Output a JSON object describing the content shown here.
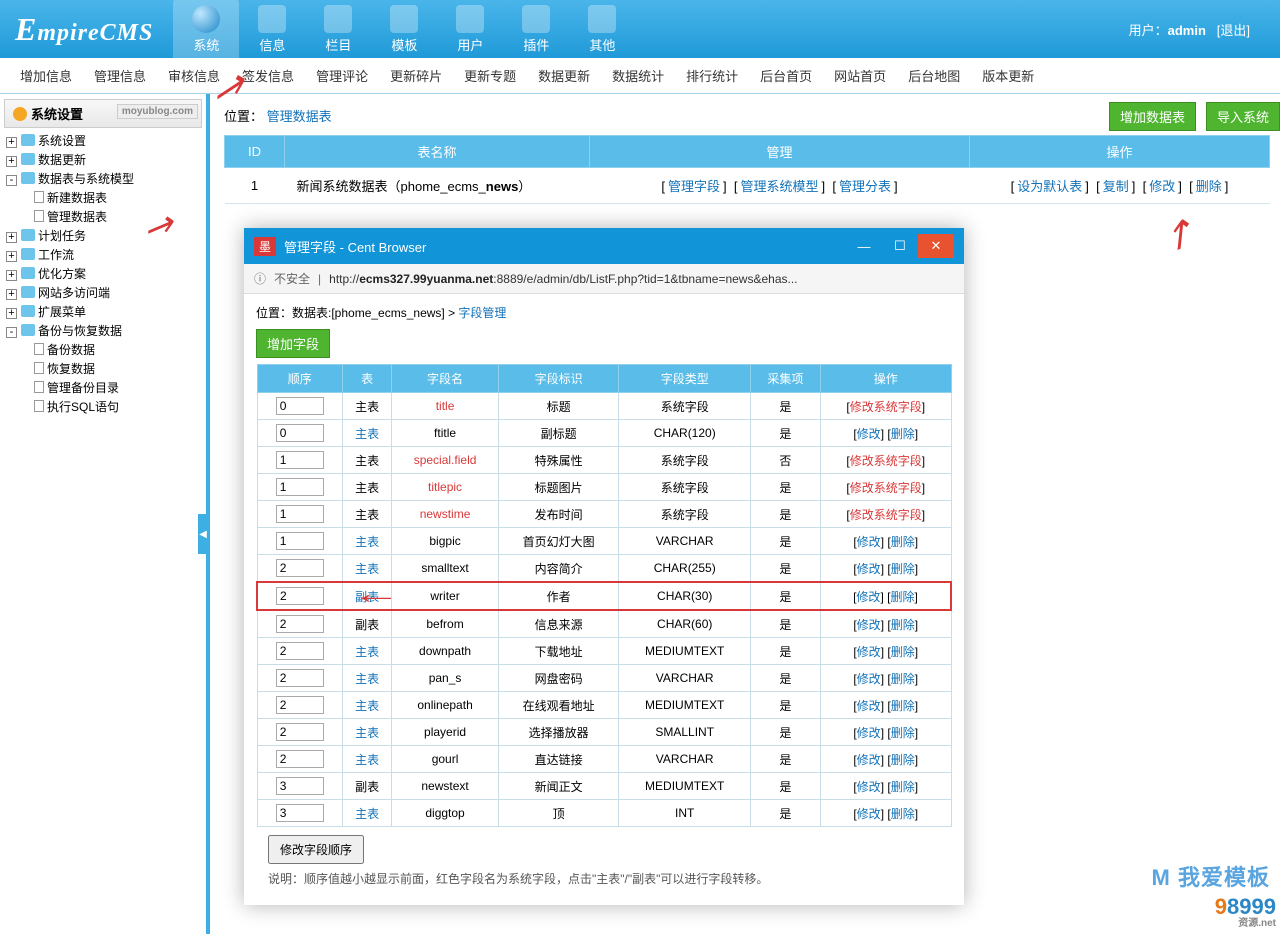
{
  "header": {
    "logo": "EmpireCMS",
    "tabs": [
      "系统",
      "信息",
      "栏目",
      "模板",
      "用户",
      "插件",
      "其他"
    ],
    "active_tab": 0,
    "user_label": "用户：",
    "user_name": "admin",
    "logout": "退出"
  },
  "subnav": [
    "增加信息",
    "管理信息",
    "审核信息",
    "签发信息",
    "管理评论",
    "更新碎片",
    "更新专题",
    "数据更新",
    "数据统计",
    "排行统计",
    "后台首页",
    "网站首页",
    "后台地图",
    "版本更新"
  ],
  "sidebar": {
    "title": "系统设置",
    "watermark": "moyublog.com",
    "items": [
      {
        "label": "系统设置",
        "toggle": "+"
      },
      {
        "label": "数据更新",
        "toggle": "+"
      },
      {
        "label": "数据表与系统模型",
        "toggle": "-",
        "children": [
          {
            "label": "新建数据表"
          },
          {
            "label": "管理数据表"
          }
        ]
      },
      {
        "label": "计划任务",
        "toggle": "+"
      },
      {
        "label": "工作流",
        "toggle": "+"
      },
      {
        "label": "优化方案",
        "toggle": "+"
      },
      {
        "label": "网站多访问端",
        "toggle": "+"
      },
      {
        "label": "扩展菜单",
        "toggle": "+"
      },
      {
        "label": "备份与恢复数据",
        "toggle": "-",
        "children": [
          {
            "label": "备份数据"
          },
          {
            "label": "恢复数据"
          },
          {
            "label": "管理备份目录"
          },
          {
            "label": "执行SQL语句"
          }
        ]
      }
    ]
  },
  "content": {
    "breadcrumb_pos": "位置：",
    "breadcrumb_link": "管理数据表",
    "btn_add": "增加数据表",
    "btn_import": "导入系统",
    "table": {
      "headers": [
        "ID",
        "表名称",
        "管理",
        "操作"
      ],
      "row": {
        "id": "1",
        "name_prefix": "新闻系统数据表（phome_ecms_",
        "name_bold": "news",
        "name_suffix": "）",
        "mgmt": [
          "管理字段",
          "管理系统模型",
          "管理分表"
        ],
        "ops": [
          "设为默认表",
          "复制",
          "修改",
          "删除"
        ]
      }
    }
  },
  "popup": {
    "title": "管理字段 - Cent Browser",
    "not_safe": "不安全",
    "url_prefix": "http://",
    "url_host": "ecms327.99yuanma.net",
    "url_rest": ":8889/e/admin/db/ListF.php?tid=1&tbname=news&ehas...",
    "crumb_pos": "位置：",
    "crumb_text": "数据表:[phome_ecms_news] > ",
    "crumb_link": "字段管理",
    "btn_addfield": "增加字段",
    "headers": [
      "顺序",
      "表",
      "字段名",
      "字段标识",
      "字段类型",
      "采集项",
      "操作"
    ],
    "rows": [
      {
        "order": "0",
        "tbl": "主表",
        "tlink": false,
        "name": "title",
        "red": true,
        "label": "标题",
        "type": "系统字段",
        "collect": "是",
        "ops": [
          {
            "t": "修改系统字段",
            "red": true
          }
        ]
      },
      {
        "order": "0",
        "tbl": "主表",
        "tlink": true,
        "name": "ftitle",
        "label": "副标题",
        "type": "CHAR(120)",
        "collect": "是",
        "ops": [
          {
            "t": "修改"
          },
          {
            "t": "删除"
          }
        ]
      },
      {
        "order": "1",
        "tbl": "主表",
        "tlink": false,
        "name": "special.field",
        "red": true,
        "label": "特殊属性",
        "type": "系统字段",
        "collect": "否",
        "ops": [
          {
            "t": "修改系统字段",
            "red": true
          }
        ]
      },
      {
        "order": "1",
        "tbl": "主表",
        "tlink": false,
        "name": "titlepic",
        "red": true,
        "label": "标题图片",
        "type": "系统字段",
        "collect": "是",
        "ops": [
          {
            "t": "修改系统字段",
            "red": true
          }
        ]
      },
      {
        "order": "1",
        "tbl": "主表",
        "tlink": false,
        "name": "newstime",
        "red": true,
        "label": "发布时间",
        "type": "系统字段",
        "collect": "是",
        "ops": [
          {
            "t": "修改系统字段",
            "red": true
          }
        ]
      },
      {
        "order": "1",
        "tbl": "主表",
        "tlink": true,
        "name": "bigpic",
        "label": "首页幻灯大图",
        "type": "VARCHAR",
        "collect": "是",
        "ops": [
          {
            "t": "修改"
          },
          {
            "t": "删除"
          }
        ]
      },
      {
        "order": "2",
        "tbl": "主表",
        "tlink": true,
        "name": "smalltext",
        "label": "内容简介",
        "type": "CHAR(255)",
        "collect": "是",
        "ops": [
          {
            "t": "修改"
          },
          {
            "t": "删除"
          }
        ]
      },
      {
        "order": "2",
        "tbl": "副表",
        "tlink": true,
        "name": "writer",
        "label": "作者",
        "type": "CHAR(30)",
        "collect": "是",
        "ops": [
          {
            "t": "修改"
          },
          {
            "t": "删除"
          }
        ],
        "hl": true
      },
      {
        "order": "2",
        "tbl": "副表",
        "tlink": false,
        "name": "befrom",
        "label": "信息来源",
        "type": "CHAR(60)",
        "collect": "是",
        "ops": [
          {
            "t": "修改"
          },
          {
            "t": "删除"
          }
        ]
      },
      {
        "order": "2",
        "tbl": "主表",
        "tlink": true,
        "name": "downpath",
        "label": "下载地址",
        "type": "MEDIUMTEXT",
        "collect": "是",
        "ops": [
          {
            "t": "修改"
          },
          {
            "t": "删除"
          }
        ]
      },
      {
        "order": "2",
        "tbl": "主表",
        "tlink": true,
        "name": "pan_s",
        "label": "网盘密码",
        "type": "VARCHAR",
        "collect": "是",
        "ops": [
          {
            "t": "修改"
          },
          {
            "t": "删除"
          }
        ]
      },
      {
        "order": "2",
        "tbl": "主表",
        "tlink": true,
        "name": "onlinepath",
        "label": "在线观看地址",
        "type": "MEDIUMTEXT",
        "collect": "是",
        "ops": [
          {
            "t": "修改"
          },
          {
            "t": "删除"
          }
        ]
      },
      {
        "order": "2",
        "tbl": "主表",
        "tlink": true,
        "name": "playerid",
        "label": "选择播放器",
        "type": "SMALLINT",
        "collect": "是",
        "ops": [
          {
            "t": "修改"
          },
          {
            "t": "删除"
          }
        ]
      },
      {
        "order": "2",
        "tbl": "主表",
        "tlink": true,
        "name": "gourl",
        "label": "直达链接",
        "type": "VARCHAR",
        "collect": "是",
        "ops": [
          {
            "t": "修改"
          },
          {
            "t": "删除"
          }
        ]
      },
      {
        "order": "3",
        "tbl": "副表",
        "tlink": false,
        "name": "newstext",
        "label": "新闻正文",
        "type": "MEDIUMTEXT",
        "collect": "是",
        "ops": [
          {
            "t": "修改"
          },
          {
            "t": "删除"
          }
        ]
      },
      {
        "order": "3",
        "tbl": "主表",
        "tlink": true,
        "name": "diggtop",
        "label": "顶",
        "type": "INT",
        "collect": "是",
        "ops": [
          {
            "t": "修改"
          },
          {
            "t": "删除"
          }
        ]
      }
    ],
    "btn_saveorder": "修改字段顺序",
    "note": "说明：顺序值越小越显示前面，红色字段名为系统字段，点击\"主表\"/\"副表\"可以进行字段转移。"
  },
  "watermarks": {
    "right": "我爱模板",
    "logo98": "98999",
    ".net": ".net"
  }
}
